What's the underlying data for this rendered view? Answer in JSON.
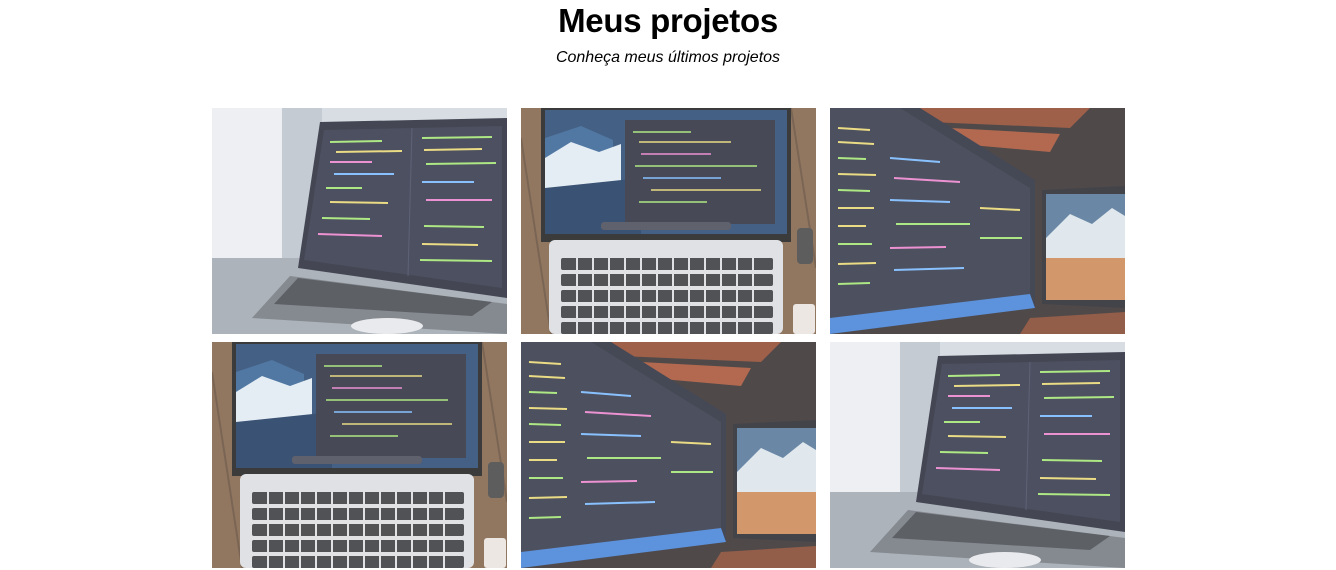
{
  "header": {
    "title": "Meus projetos",
    "subtitle": "Conheça meus últimos projetos"
  },
  "projects": [
    {
      "image": "laptop-side-code-photo"
    },
    {
      "image": "macbook-top-keyboard-photo"
    },
    {
      "image": "monitor-code-mountain-photo"
    },
    {
      "image": "macbook-top-keyboard-photo"
    },
    {
      "image": "monitor-code-mountain-photo"
    },
    {
      "image": "laptop-side-code-photo"
    }
  ],
  "colors": {
    "background": "#ffffff",
    "title": "#000000",
    "code_green": "#9be36a",
    "code_yellow": "#e6d36b",
    "code_pink": "#e879c8",
    "code_blue": "#6fb4ff",
    "wood": "#7a5a3e"
  }
}
